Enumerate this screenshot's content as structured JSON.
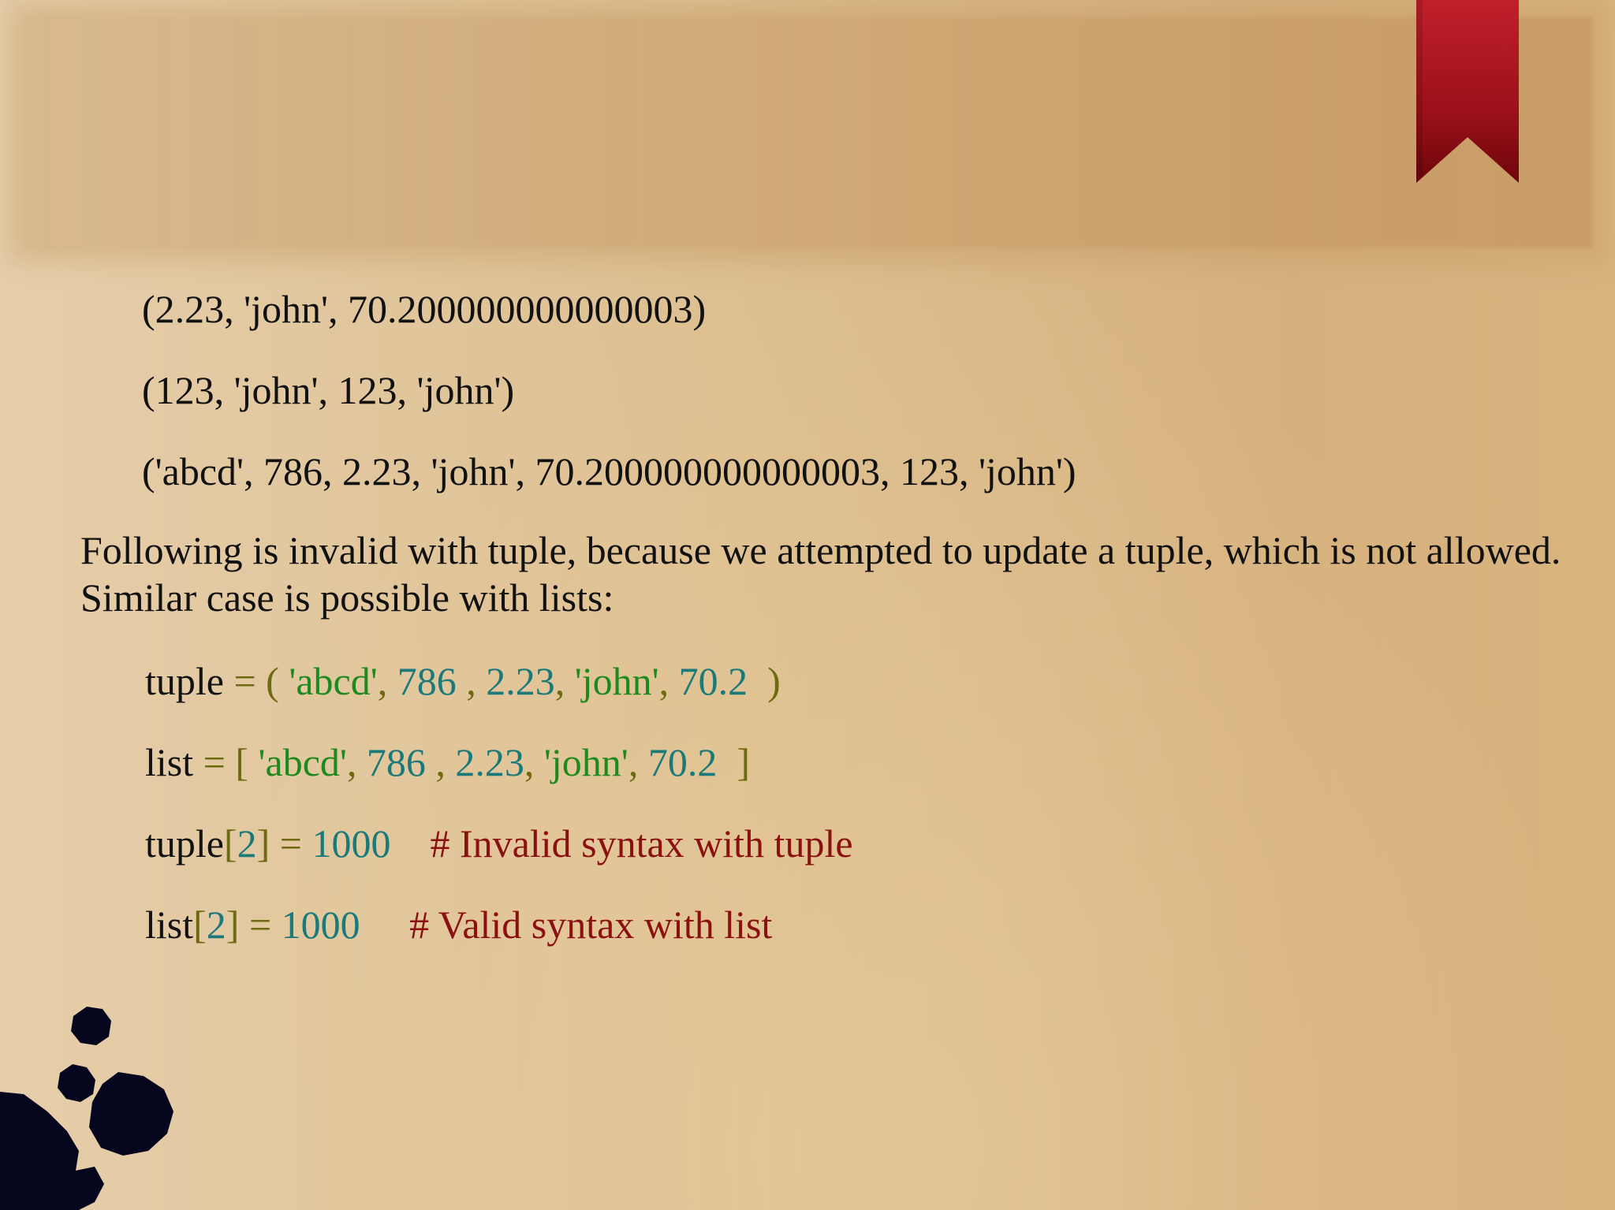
{
  "outputs": [
    "(2.23, 'john', 70.200000000000003)",
    "(123, 'john', 123, 'john')",
    "('abcd', 786, 2.23, 'john', 70.200000000000003, 123, 'john')"
  ],
  "paragraph": "Following is invalid with tuple, because we attempted to update a tuple, which is not allowed. Similar case is possible with lists:",
  "code": {
    "tuple_line": {
      "name": "tuple",
      "assign": " = ( ",
      "s1": "'abcd'",
      "sep1": ", ",
      "n1": "786",
      "sep2": " , ",
      "n2": "2.23",
      "sep3": ", ",
      "s2": "'john'",
      "sep4": ", ",
      "n3": "70.2",
      "close": "  )"
    },
    "list_line": {
      "name": "list",
      "assign": " = [ ",
      "s1": "'abcd'",
      "sep1": ", ",
      "n1": "786",
      "sep2": " , ",
      "n2": "2.23",
      "sep3": ", ",
      "s2": "'john'",
      "sep4": ", ",
      "n3": "70.2",
      "close": "  ]"
    },
    "tuple_assign": {
      "name": "tuple",
      "open": "[",
      "index": "2",
      "close": "]",
      "eq": " = ",
      "value": "1000",
      "comment": "    # Invalid syntax with tuple"
    },
    "list_assign": {
      "name": "list",
      "open": "[",
      "index": "2",
      "close": "]",
      "eq": " = ",
      "value": "1000",
      "comment": "     # Valid syntax with list"
    }
  },
  "colors": {
    "bookmark": "#a8141c",
    "ink": "#05061e",
    "operator": "#6e6a12",
    "string": "#1e8a1e",
    "number": "#1a7a7a",
    "comment": "#8b1010"
  }
}
